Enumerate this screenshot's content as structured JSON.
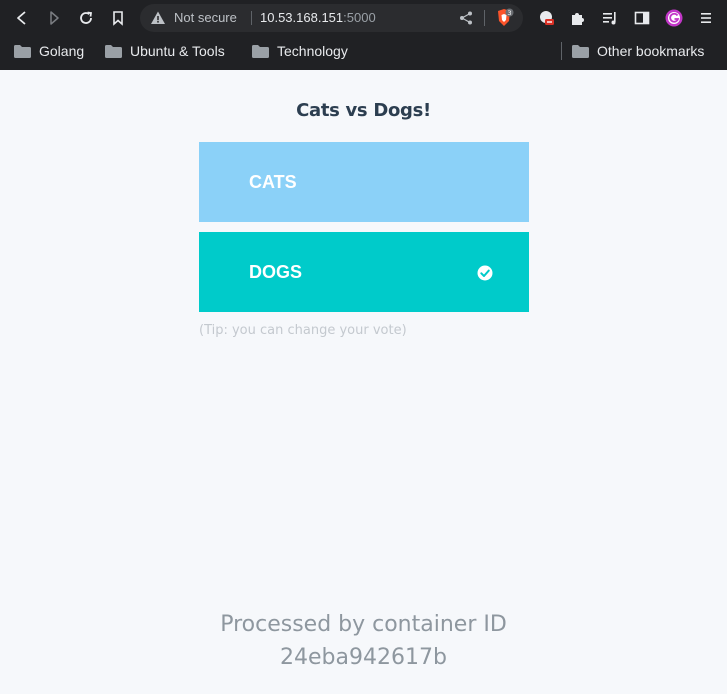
{
  "browser": {
    "security_label": "Not secure",
    "url_host": "10.53.168.151",
    "url_port": ":5000",
    "brave_badge": "3",
    "bookmarks": [
      {
        "label": "Golang"
      },
      {
        "label": "Ubuntu & Tools"
      },
      {
        "label": "Technology"
      }
    ],
    "other_bookmarks": "Other bookmarks"
  },
  "page": {
    "title": "Cats vs Dogs!",
    "options": [
      {
        "label": "CATS",
        "color": "#8bd1f8",
        "selected": false
      },
      {
        "label": "DOGS",
        "color": "#00cbca",
        "selected": true
      }
    ],
    "tip": "(Tip: you can change your vote)",
    "footer_line1": "Processed by container ID",
    "footer_line2": "24eba942617b"
  }
}
